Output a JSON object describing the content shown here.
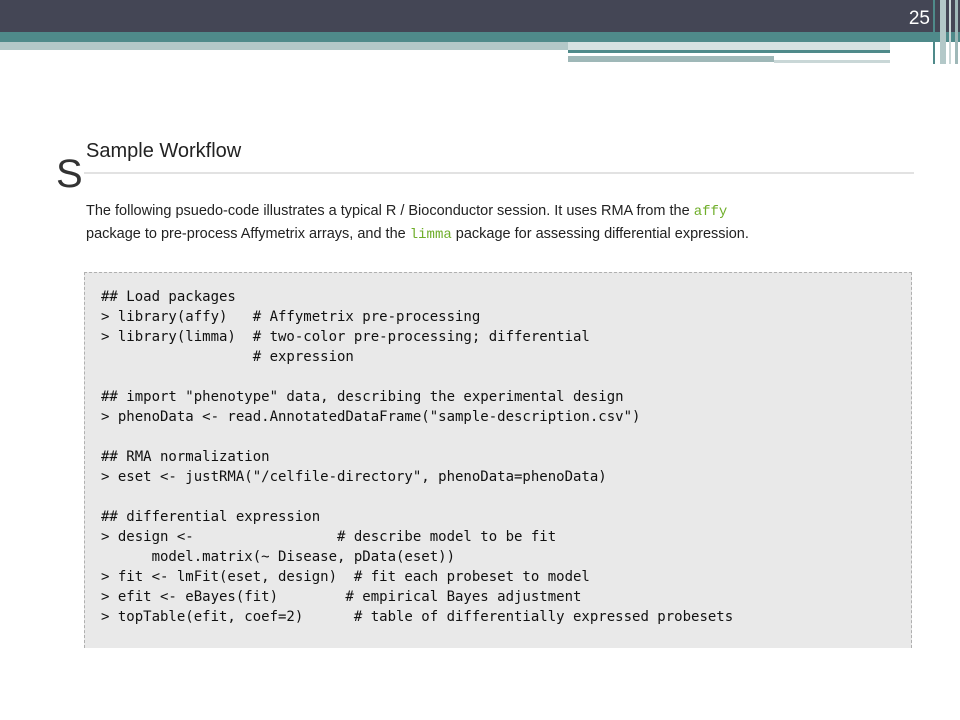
{
  "slide": {
    "number": "25",
    "title_visible_fragment": "S"
  },
  "panel": {
    "heading": "Sample Workflow",
    "intro": {
      "part1": "The following psuedo-code illustrates a typical R / Bioconductor session. It uses RMA from the ",
      "pkg1": "affy",
      "part2": " package to pre-process Affymetrix arrays, and the ",
      "pkg2": "limma",
      "part3": " package for assessing differential expression."
    },
    "code_lines": [
      "## Load packages",
      "> library(affy)   # Affymetrix pre-processing",
      "> library(limma)  # two-color pre-processing; differential",
      "                  # expression",
      "",
      "## import \"phenotype\" data, describing the experimental design",
      "> phenoData <- read.AnnotatedDataFrame(\"sample-description.csv\")",
      "",
      "## RMA normalization",
      "> eset <- justRMA(\"/celfile-directory\", phenoData=phenoData)",
      "",
      "## differential expression",
      "> design <-                 # describe model to be fit",
      "      model.matrix(~ Disease, pData(eset))",
      "> fit <- lmFit(eset, design)  # fit each probeset to model",
      "> efit <- eBayes(fit)        # empirical Bayes adjustment",
      "> topTable(efit, coef=2)      # table of differentially expressed probesets"
    ]
  },
  "colors": {
    "header_dark": "#444655",
    "header_teal": "#4f8a8a",
    "package_green": "#6fae2a",
    "code_background": "#e9e9e9"
  }
}
